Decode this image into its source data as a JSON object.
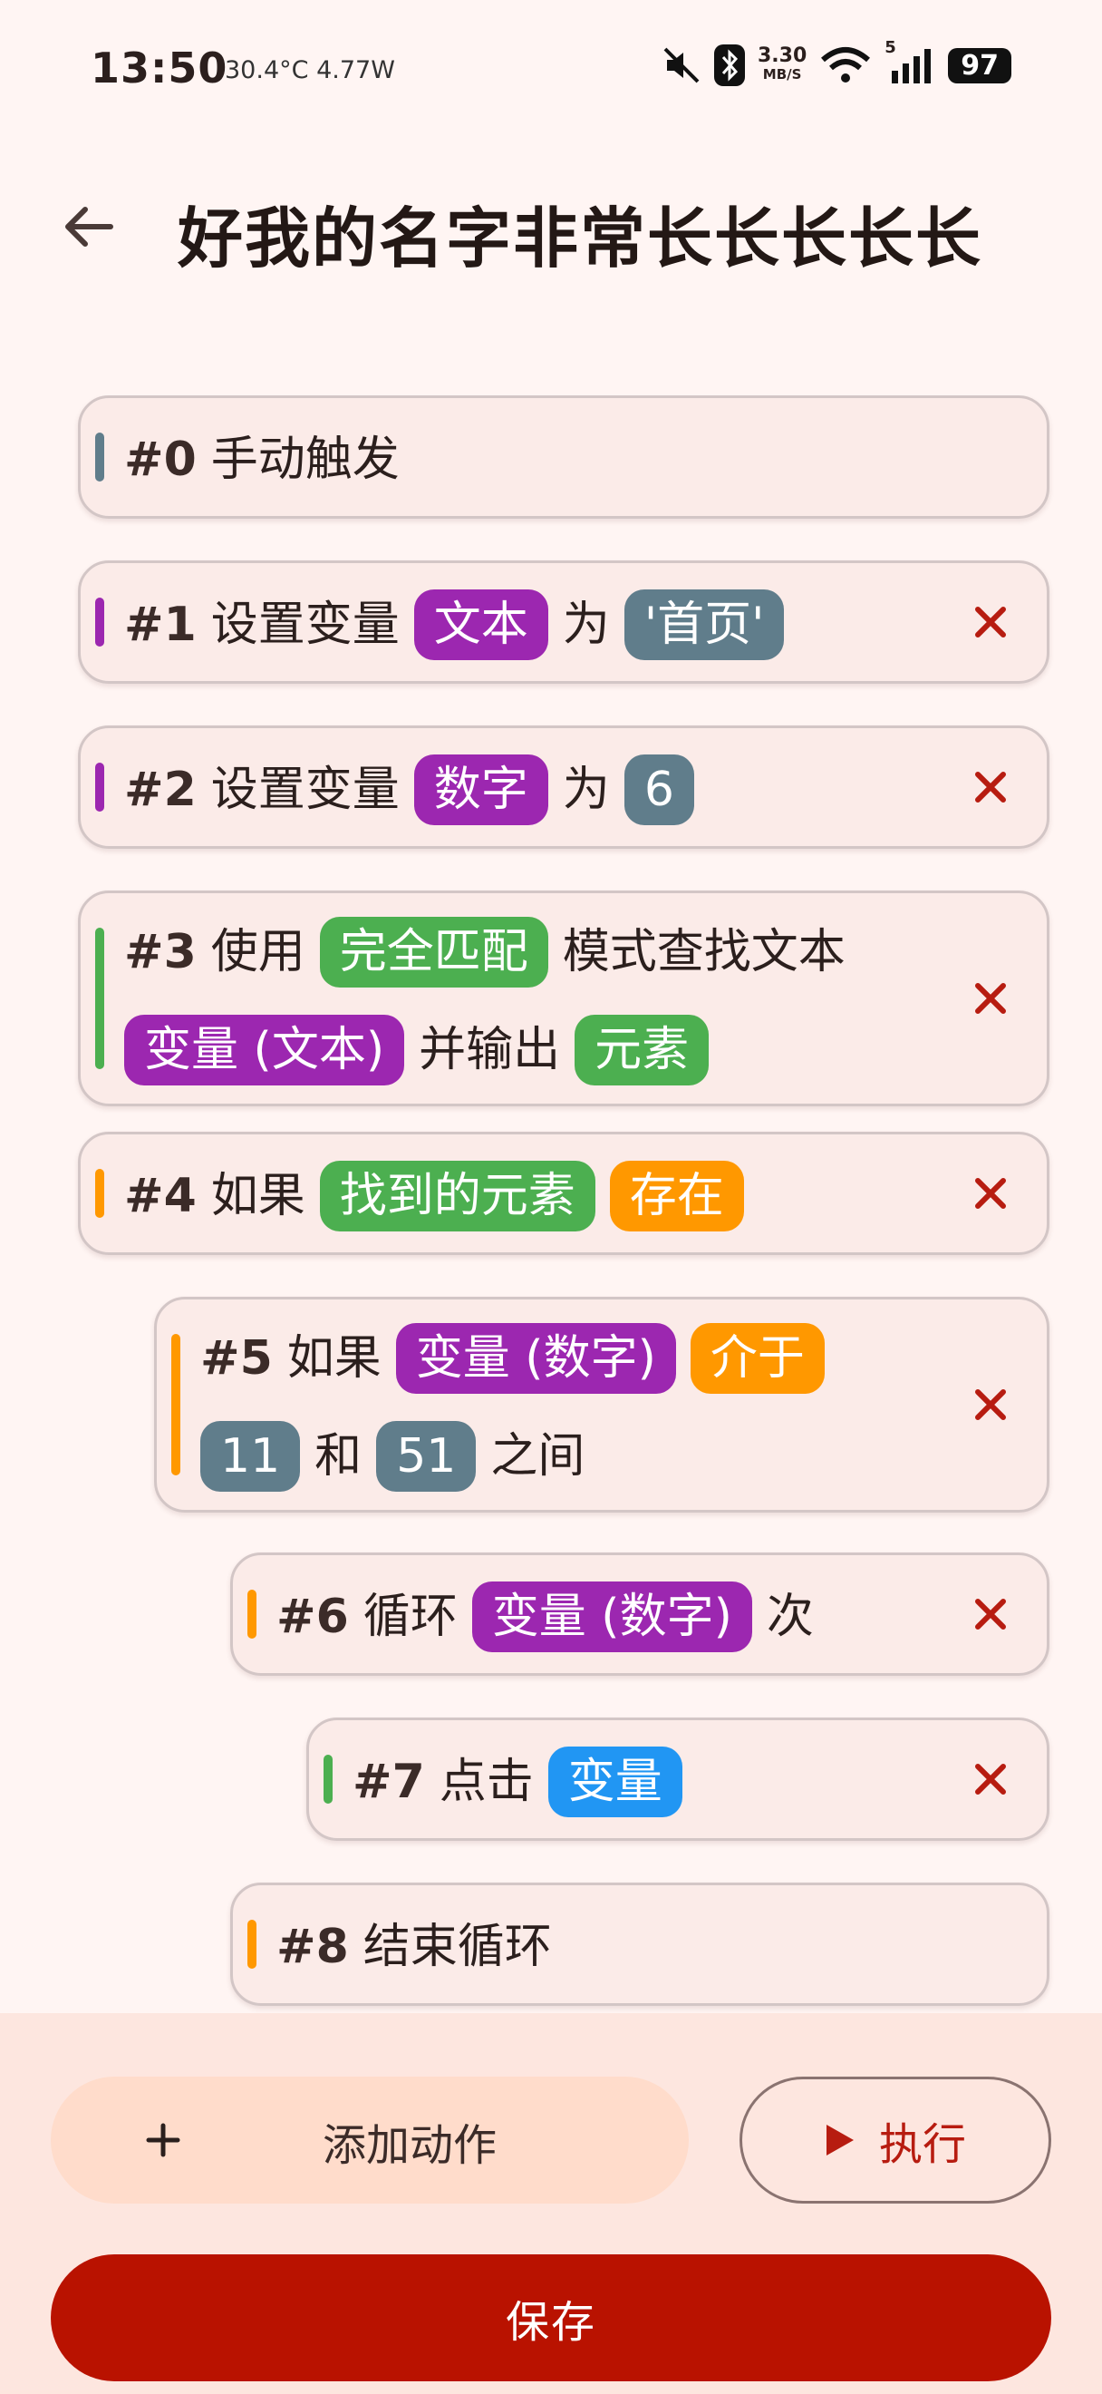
{
  "status_bar": {
    "time": "13:50",
    "temperature": "30.4°C",
    "power": "4.77W",
    "net_speed_value": "3.30",
    "net_speed_unit": "MB/S",
    "signal_label": "5",
    "battery": "97"
  },
  "app_bar": {
    "back_icon": "arrow-left-icon",
    "title": "好我的名字非常长长长长长"
  },
  "actions": [
    {
      "index": "#0",
      "accent": "#607d8b",
      "lines": [
        [
          {
            "t": "text",
            "v": "手动触发"
          }
        ]
      ],
      "deletable": false
    },
    {
      "index": "#1",
      "accent": "#9c27b0",
      "lines": [
        [
          {
            "t": "text",
            "v": "设置变量"
          },
          {
            "t": "chip",
            "v": "文本",
            "c": "#9c27b0"
          },
          {
            "t": "text",
            "v": "为"
          },
          {
            "t": "chip",
            "v": "'首页'",
            "c": "#607d8b"
          }
        ]
      ],
      "deletable": true
    },
    {
      "index": "#2",
      "accent": "#9c27b0",
      "lines": [
        [
          {
            "t": "text",
            "v": "设置变量"
          },
          {
            "t": "chip",
            "v": "数字",
            "c": "#9c27b0"
          },
          {
            "t": "text",
            "v": "为"
          },
          {
            "t": "chip",
            "v": "6",
            "c": "#607d8b"
          }
        ]
      ],
      "deletable": true
    },
    {
      "index": "#3",
      "accent": "#4caf50",
      "lines": [
        [
          {
            "t": "text",
            "v": "使用"
          },
          {
            "t": "chip",
            "v": "完全匹配",
            "c": "#4caf50"
          },
          {
            "t": "text",
            "v": "模式查找文本"
          }
        ],
        [
          {
            "t": "chip",
            "v": "变量 (文本)",
            "c": "#9c27b0"
          },
          {
            "t": "text",
            "v": "并输出"
          },
          {
            "t": "chip",
            "v": "元素",
            "c": "#4caf50"
          }
        ]
      ],
      "deletable": true
    },
    {
      "index": "#4",
      "accent": "#ff9800",
      "lines": [
        [
          {
            "t": "text",
            "v": "如果"
          },
          {
            "t": "chip",
            "v": "找到的元素",
            "c": "#4caf50"
          },
          {
            "t": "chip",
            "v": "存在",
            "c": "#ff9800"
          }
        ]
      ],
      "deletable": true
    },
    {
      "index": "#5",
      "accent": "#ff9800",
      "lines": [
        [
          {
            "t": "text",
            "v": "如果"
          },
          {
            "t": "chip",
            "v": "变量 (数字)",
            "c": "#9c27b0"
          },
          {
            "t": "chip",
            "v": "介于",
            "c": "#ff9800"
          }
        ],
        [
          {
            "t": "chip",
            "v": "11",
            "c": "#607d8b"
          },
          {
            "t": "text",
            "v": "和"
          },
          {
            "t": "chip",
            "v": "51",
            "c": "#607d8b"
          },
          {
            "t": "text",
            "v": "之间"
          }
        ]
      ],
      "deletable": true
    },
    {
      "index": "#6",
      "accent": "#ff9800",
      "lines": [
        [
          {
            "t": "text",
            "v": "循环"
          },
          {
            "t": "chip",
            "v": "变量 (数字)",
            "c": "#9c27b0"
          },
          {
            "t": "text",
            "v": "次"
          }
        ]
      ],
      "deletable": true
    },
    {
      "index": "#7",
      "accent": "#4caf50",
      "lines": [
        [
          {
            "t": "text",
            "v": "点击"
          },
          {
            "t": "chip",
            "v": "变量",
            "c": "#2196f3"
          }
        ]
      ],
      "deletable": true
    },
    {
      "index": "#8",
      "accent": "#ff9800",
      "lines": [
        [
          {
            "t": "text",
            "v": "结束循环"
          }
        ]
      ],
      "deletable": false
    }
  ],
  "buttons": {
    "add_label": "添加动作",
    "add_icon": "plus-icon",
    "run_label": "执行",
    "run_icon": "play-icon",
    "save_label": "保存"
  },
  "colors": {
    "delete_icon": "#b71c10",
    "primary": "#b91200"
  }
}
